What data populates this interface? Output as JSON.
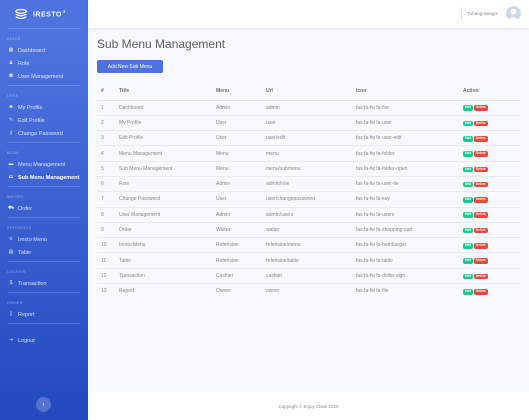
{
  "brand": {
    "name": "IRESTO",
    "sup": "3"
  },
  "sidebar": {
    "sections": [
      {
        "heading": "ADMIN",
        "items": [
          {
            "label": "Dashboard",
            "icon": "tachometer-icon",
            "glyph": "▦"
          },
          {
            "label": "Role",
            "icon": "user-tie-icon",
            "glyph": "♟"
          },
          {
            "label": "User Management",
            "icon": "users-icon",
            "glyph": "⚉"
          }
        ]
      },
      {
        "heading": "USER",
        "items": [
          {
            "label": "My Profile",
            "icon": "user-icon",
            "glyph": "☻"
          },
          {
            "label": "Edit Profile",
            "icon": "user-edit-icon",
            "glyph": "✎"
          },
          {
            "label": "Change Password",
            "icon": "key-icon",
            "glyph": "⚷"
          }
        ]
      },
      {
        "heading": "MENU",
        "items": [
          {
            "label": "Menu Management",
            "icon": "folder-icon",
            "glyph": "▬"
          },
          {
            "label": "Sub Menu Management",
            "icon": "folder-open-icon",
            "glyph": "▭",
            "active": true
          }
        ]
      },
      {
        "heading": "WAITER",
        "items": [
          {
            "label": "Order",
            "icon": "shopping-cart-icon",
            "glyph": "⛟"
          }
        ]
      },
      {
        "heading": "REFENSION",
        "items": [
          {
            "label": "Iresto Menu",
            "icon": "hamburger-icon",
            "glyph": "≡"
          },
          {
            "label": "Table",
            "icon": "table-icon",
            "glyph": "▤"
          }
        ]
      },
      {
        "heading": "CASHIER",
        "items": [
          {
            "label": "Transaction",
            "icon": "dollar-sign-icon",
            "glyph": "$"
          }
        ]
      },
      {
        "heading": "OWNER",
        "items": [
          {
            "label": "Report",
            "icon": "file-icon",
            "glyph": "▯"
          }
        ]
      }
    ],
    "logout": {
      "label": "Logout",
      "icon": "sign-out-icon",
      "glyph": "⇥"
    },
    "toggle_glyph": "‹"
  },
  "topbar": {
    "username": "Tubang Neagor"
  },
  "page": {
    "title": "Sub Menu Management",
    "add_button": "Add New Sub Menu"
  },
  "table": {
    "headers": [
      "#",
      "Title",
      "Menu",
      "Url",
      "Icon",
      "Action"
    ],
    "edit_label": "Edit",
    "delete_label": "Delete",
    "rows": [
      [
        "1",
        "Dashboard",
        "Admin",
        "admin",
        "fas fa-fw fa-fire"
      ],
      [
        "2",
        "My Profile",
        "User",
        "user",
        "fas fa-fw fa-user"
      ],
      [
        "3",
        "Edit Profile",
        "User",
        "user/edit",
        "fas fa-fw fa-user-edit"
      ],
      [
        "4",
        "Menu Management",
        "Menu",
        "menu",
        "fas fa-fw fa-folder"
      ],
      [
        "5",
        "Sub Menu Management",
        "Menu",
        "menu/submenu",
        "fas fa-fw fa-folder-open"
      ],
      [
        "6",
        "Role",
        "Admin",
        "admin/role",
        "fas fa-fw fa-user-tie"
      ],
      [
        "7",
        "Change Password",
        "User",
        "user/changepassword",
        "fas fa-fw fa-key"
      ],
      [
        "8",
        "User Management",
        "Admin",
        "admin/users",
        "fas fa-fw fa-users"
      ],
      [
        "9",
        "Order",
        "Waiter",
        "waiter",
        "fas fa-fw fa-shopping-cart"
      ],
      [
        "10",
        "Iresto Menu",
        "Refension",
        "refension/menu",
        "fas fa-fw fa-hamburger"
      ],
      [
        "11",
        "Table",
        "Refension",
        "refension/table",
        "fas fa-fw fa-table"
      ],
      [
        "12",
        "Transaction",
        "Cashier",
        "cashier",
        "fas fa-fw fa-dollar-sign"
      ],
      [
        "13",
        "Report",
        "Owner",
        "owner",
        "fas fa-fw fa-file"
      ]
    ]
  },
  "footer": {
    "text": "Copyright © Enjoy Class 2020"
  },
  "colors": {
    "primary": "#4e73df",
    "success": "#1cc88a",
    "danger": "#e74a3b"
  }
}
